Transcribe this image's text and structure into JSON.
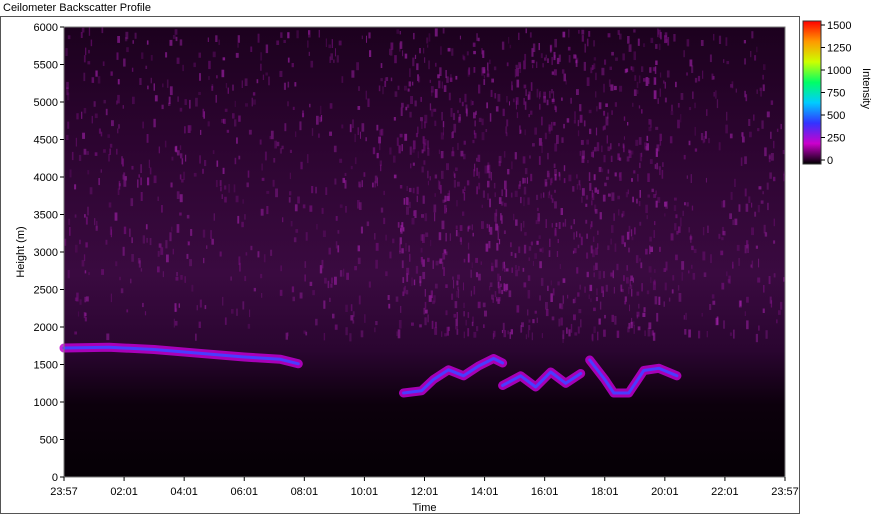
{
  "window": {
    "title": "Ceilometer Backscatter Profile"
  },
  "chart_data": {
    "type": "heatmap",
    "title": "Ceilometer Backscatter Profile",
    "xlabel": "Time",
    "ylabel": "Height (m)",
    "x_ticks": [
      "23:57",
      "02:01",
      "04:01",
      "06:01",
      "08:01",
      "10:01",
      "12:01",
      "14:01",
      "16:01",
      "18:01",
      "20:01",
      "22:01",
      "23:57"
    ],
    "y_ticks": [
      "0",
      "500",
      "1000",
      "1500",
      "2000",
      "2500",
      "3000",
      "3500",
      "4000",
      "4500",
      "5000",
      "5500",
      "6000"
    ],
    "ylim": [
      0,
      6000
    ],
    "xlim_hours": [
      0,
      24
    ],
    "colorbar": {
      "label": "Intensity",
      "ticks": [
        "0",
        "250",
        "500",
        "750",
        "1000",
        "1250",
        "1500"
      ],
      "range": [
        0,
        1500
      ],
      "colors": [
        "#000000",
        "#cc00cc",
        "#3333ff",
        "#00ccff",
        "#00ff66",
        "#ccff00",
        "#ff9900",
        "#ff0000"
      ]
    },
    "cloud_layers": [
      {
        "name": "",
        "points": [
          [
            0.0,
            1720
          ],
          [
            1.5,
            1730
          ],
          [
            3.0,
            1700
          ],
          [
            4.5,
            1650
          ],
          [
            6.0,
            1600
          ],
          [
            7.2,
            1570
          ],
          [
            7.8,
            1510
          ]
        ]
      },
      {
        "name": "",
        "points": [
          [
            11.3,
            1120
          ],
          [
            11.9,
            1150
          ],
          [
            12.3,
            1300
          ],
          [
            12.8,
            1430
          ],
          [
            13.3,
            1350
          ],
          [
            13.8,
            1480
          ],
          [
            14.3,
            1580
          ],
          [
            14.6,
            1520
          ]
        ]
      },
      {
        "name": "",
        "points": [
          [
            14.6,
            1220
          ],
          [
            15.2,
            1350
          ],
          [
            15.7,
            1200
          ],
          [
            16.2,
            1400
          ],
          [
            16.7,
            1250
          ],
          [
            17.2,
            1380
          ]
        ]
      },
      {
        "name": "",
        "points": [
          [
            17.5,
            1560
          ],
          [
            18.0,
            1300
          ],
          [
            18.3,
            1120
          ],
          [
            18.8,
            1120
          ],
          [
            19.3,
            1420
          ],
          [
            19.8,
            1450
          ],
          [
            20.4,
            1350
          ]
        ]
      }
    ]
  }
}
